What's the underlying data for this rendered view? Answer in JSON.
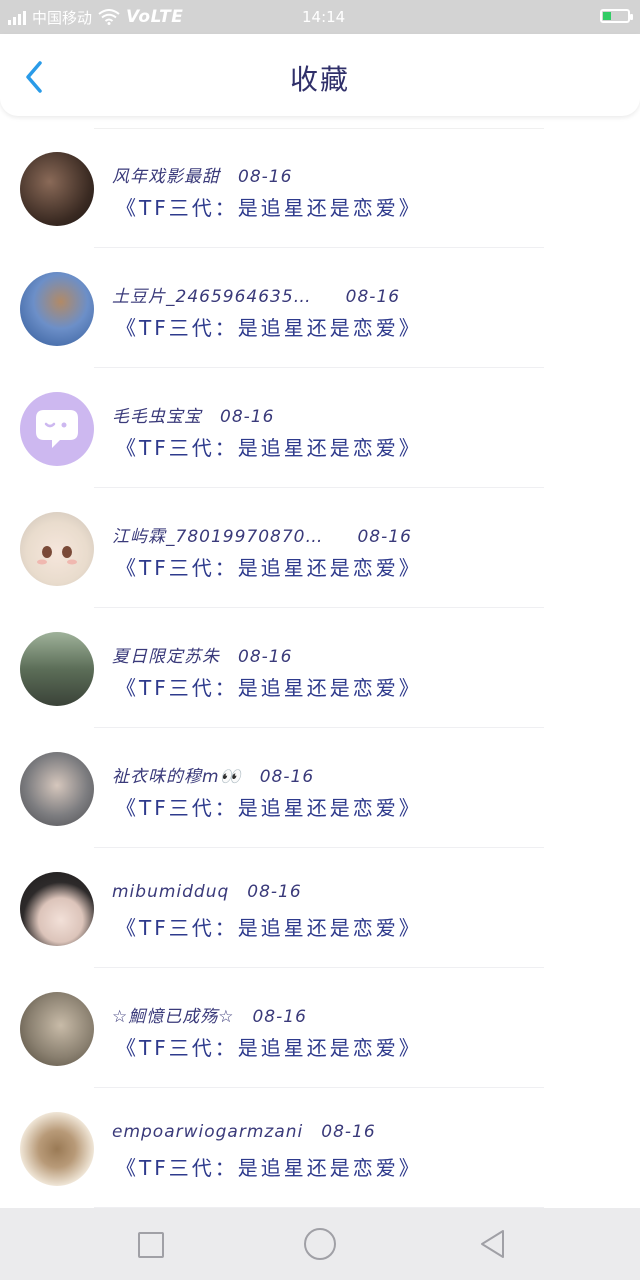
{
  "status_bar": {
    "carrier": "中国移动",
    "network": "VoLTE",
    "time": "14:14",
    "signal_icon": "signal-icon",
    "wifi_icon": "wifi-icon",
    "battery_icon": "battery-icon",
    "battery_color": "#33cc66"
  },
  "header": {
    "title": "收藏",
    "back_icon": "chevron-left-icon",
    "accent_color": "#2a9be8"
  },
  "favorites": [
    {
      "user": "风年戏影最甜",
      "date": "08-16",
      "title": "《TF三代：是追星还是恋爱》",
      "avatar_color": "#3a2a22"
    },
    {
      "user": "土豆片_2465964635…",
      "date": "08-16",
      "title": "《TF三代：是追星还是恋爱》",
      "avatar_color": "#4a7fc0"
    },
    {
      "user": "毛毛虫宝宝",
      "date": "08-16",
      "title": "《TF三代：是追星还是恋爱》",
      "avatar_color": "#cdb8f0"
    },
    {
      "user": "江屿霖_78019970870…",
      "date": "08-16",
      "title": "《TF三代：是追星还是恋爱》",
      "avatar_color": "#e9dccd"
    },
    {
      "user": "夏日限定苏朱",
      "date": "08-16",
      "title": "《TF三代：是追星还是恋爱》",
      "avatar_color": "#5c6e58"
    },
    {
      "user": "祉衣味的穆m👀",
      "date": "08-16",
      "title": "《TF三代：是追星还是恋爱》",
      "avatar_color": "#7d7d80"
    },
    {
      "user": "mibumidduq",
      "date": "08-16",
      "title": "《TF三代：是追星还是恋爱》",
      "avatar_color": "#2d2a2a"
    },
    {
      "user": "☆鮰憶已成殇☆",
      "date": "08-16",
      "title": "《TF三代：是追星还是恋爱》",
      "avatar_color": "#8a8070"
    },
    {
      "user": "empoarwiogarmzani",
      "date": "08-16",
      "title": "《TF三代：是追星还是恋爱》",
      "avatar_color": "#9a7a55"
    }
  ],
  "system_nav": {
    "recents_icon": "square-icon",
    "home_icon": "circle-icon",
    "back_icon": "triangle-back-icon"
  }
}
